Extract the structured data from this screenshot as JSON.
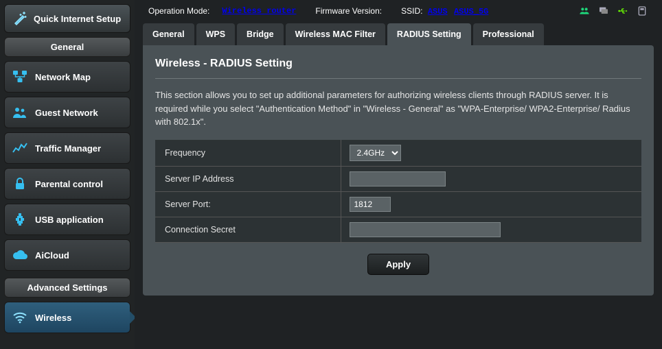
{
  "sidebar": {
    "qis": "Quick Internet Setup",
    "general_header": "General",
    "items": [
      {
        "label": "Network Map"
      },
      {
        "label": "Guest Network"
      },
      {
        "label": "Traffic Manager"
      },
      {
        "label": "Parental control"
      },
      {
        "label": "USB application"
      },
      {
        "label": "AiCloud"
      }
    ],
    "advanced_header": "Advanced Settings",
    "adv_items": [
      {
        "label": "Wireless"
      }
    ]
  },
  "header": {
    "op_label": "Operation Mode:",
    "op_value": "Wireless router",
    "fw_label": "Firmware Version:",
    "ssid_label": "SSID:",
    "ssid1": "ASUS",
    "ssid2": "ASUS_5G"
  },
  "tabs": [
    "General",
    "WPS",
    "Bridge",
    "Wireless MAC Filter",
    "RADIUS Setting",
    "Professional"
  ],
  "active_tab": 4,
  "panel": {
    "title": "Wireless - RADIUS Setting",
    "desc": "This section allows you to set up additional parameters for authorizing wireless clients through RADIUS server. It is required while you select \"Authentication Method\" in \"Wireless - General\" as \"WPA-Enterprise/ WPA2-Enterprise/ Radius with 802.1x\"."
  },
  "form": {
    "rows": [
      {
        "label": "Frequency",
        "type": "select",
        "value": "2.4GHz"
      },
      {
        "label": "Server IP Address",
        "type": "text",
        "value": ""
      },
      {
        "label": "Server Port:",
        "type": "text",
        "value": "1812"
      },
      {
        "label": "Connection Secret",
        "type": "password",
        "value": ""
      }
    ],
    "apply": "Apply"
  }
}
